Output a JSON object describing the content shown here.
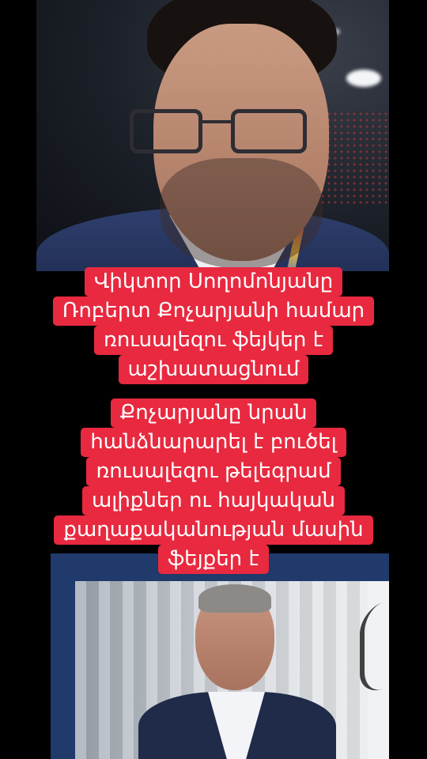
{
  "caption_top": {
    "lines": [
      "Վիկտոր Սողոմոնյանը",
      "Ռոբերտ Քոչարյանի համար",
      "ռուսալեզու ֆեյկեր է",
      "աշխատացնում"
    ]
  },
  "caption_bottom": {
    "lines": [
      "Քոչարյանը նրան",
      "հանձնարարել է բուծել",
      "ռուսալեզու թելեգրամ",
      "ալիքներ ու հայկական",
      "քաղաքականության մասին",
      "ֆեյքեր է"
    ]
  },
  "colors": {
    "caption_background": "#e8293f",
    "caption_text": "#ffffff",
    "page_background": "#000000"
  }
}
